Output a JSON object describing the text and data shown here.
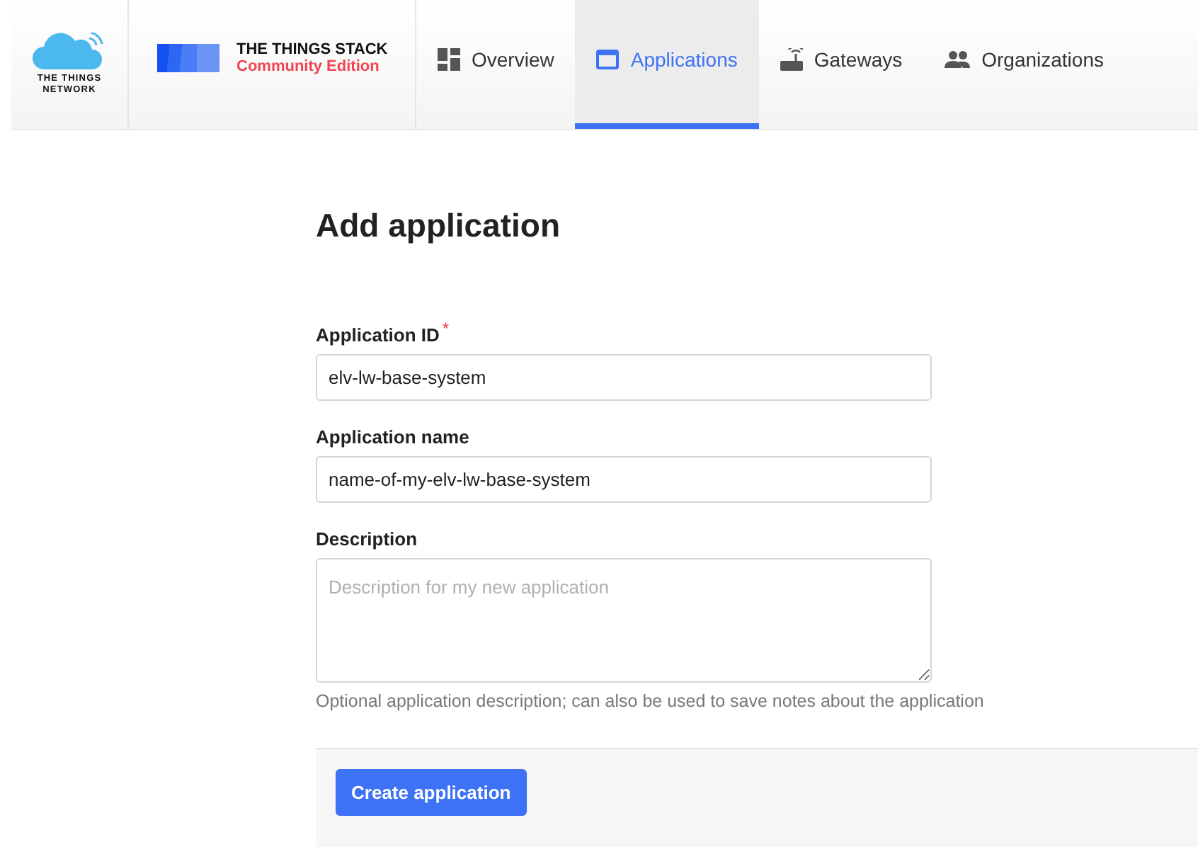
{
  "brand": {
    "network_logo": [
      "THE THINGS",
      "NETWORK"
    ],
    "stack_title": "THE THINGS STACK",
    "stack_edition": "Community Edition"
  },
  "nav": [
    {
      "label": "Overview",
      "selected": false
    },
    {
      "label": "Applications",
      "selected": true
    },
    {
      "label": "Gateways",
      "selected": false
    },
    {
      "label": "Organizations",
      "selected": false
    }
  ],
  "page_title": "Add application",
  "fields": [
    {
      "kind": "input",
      "label": "Application ID",
      "required_mark": "*",
      "value": "elv-lw-base-system"
    },
    {
      "kind": "input",
      "label": "Application name",
      "value": "name-of-my-elv-lw-base-system"
    },
    {
      "kind": "textarea",
      "label": "Description",
      "placeholder": "Description for my new application",
      "hint": "Optional application description; can also be used to save notes about the application"
    }
  ],
  "submit_button": "Create application"
}
